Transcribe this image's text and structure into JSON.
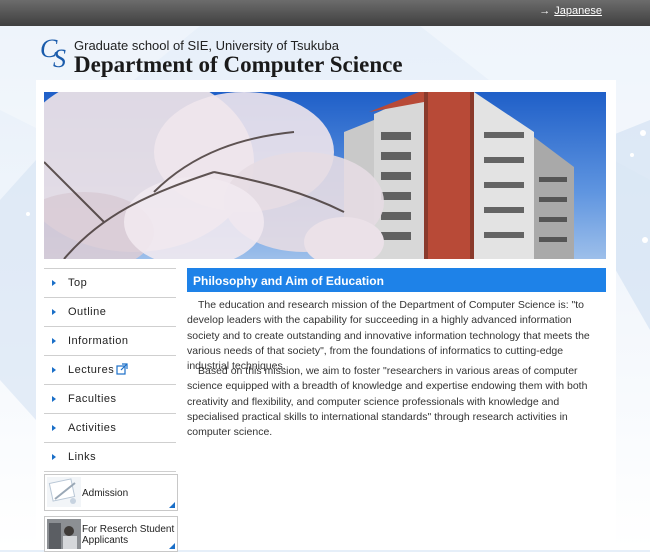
{
  "topbar": {
    "lang_link": "Japanese"
  },
  "header": {
    "logo_letters": [
      "C",
      "S"
    ],
    "subtitle": "Graduate school of SIE, University of Tsukuba",
    "title": "Department of Computer Science"
  },
  "hero": {
    "image": "campus-building-cherry-blossoms"
  },
  "nav": {
    "items": [
      {
        "label": "Top"
      },
      {
        "label": "Outline"
      },
      {
        "label": "Information"
      },
      {
        "label": "Lectures",
        "icon": "external-link-icon"
      },
      {
        "label": "Faculties"
      },
      {
        "label": "Activities"
      },
      {
        "label": "Links"
      }
    ]
  },
  "banners": [
    {
      "label": "Admission",
      "image": "admission-documents"
    },
    {
      "label_line1": "For Reserch Student",
      "label_line2": "Applicants",
      "image": "research-students"
    }
  ],
  "main": {
    "heading": "Philosophy and Aim of Education",
    "paragraphs": [
      "The education and research mission of the Department of Computer Science is: \"to develop leaders with the capability for succeeding in a highly advanced information society and to create outstanding and innovative information technology that meets the various needs of that society\", from the foundations of informatics to cutting-edge industrial techniques.",
      "Based on this mission, we aim to foster \"researchers in various areas of computer science equipped with a breadth of knowledge and expertise endowing them with both creativity and flexibility, and computer science professionals with knowledge and specialised practical skills to international standards\" through research activities in computer science."
    ]
  },
  "colors": {
    "accent": "#1e82e8",
    "brand": "#1a5bab",
    "topbar": "#4a4a4a"
  }
}
